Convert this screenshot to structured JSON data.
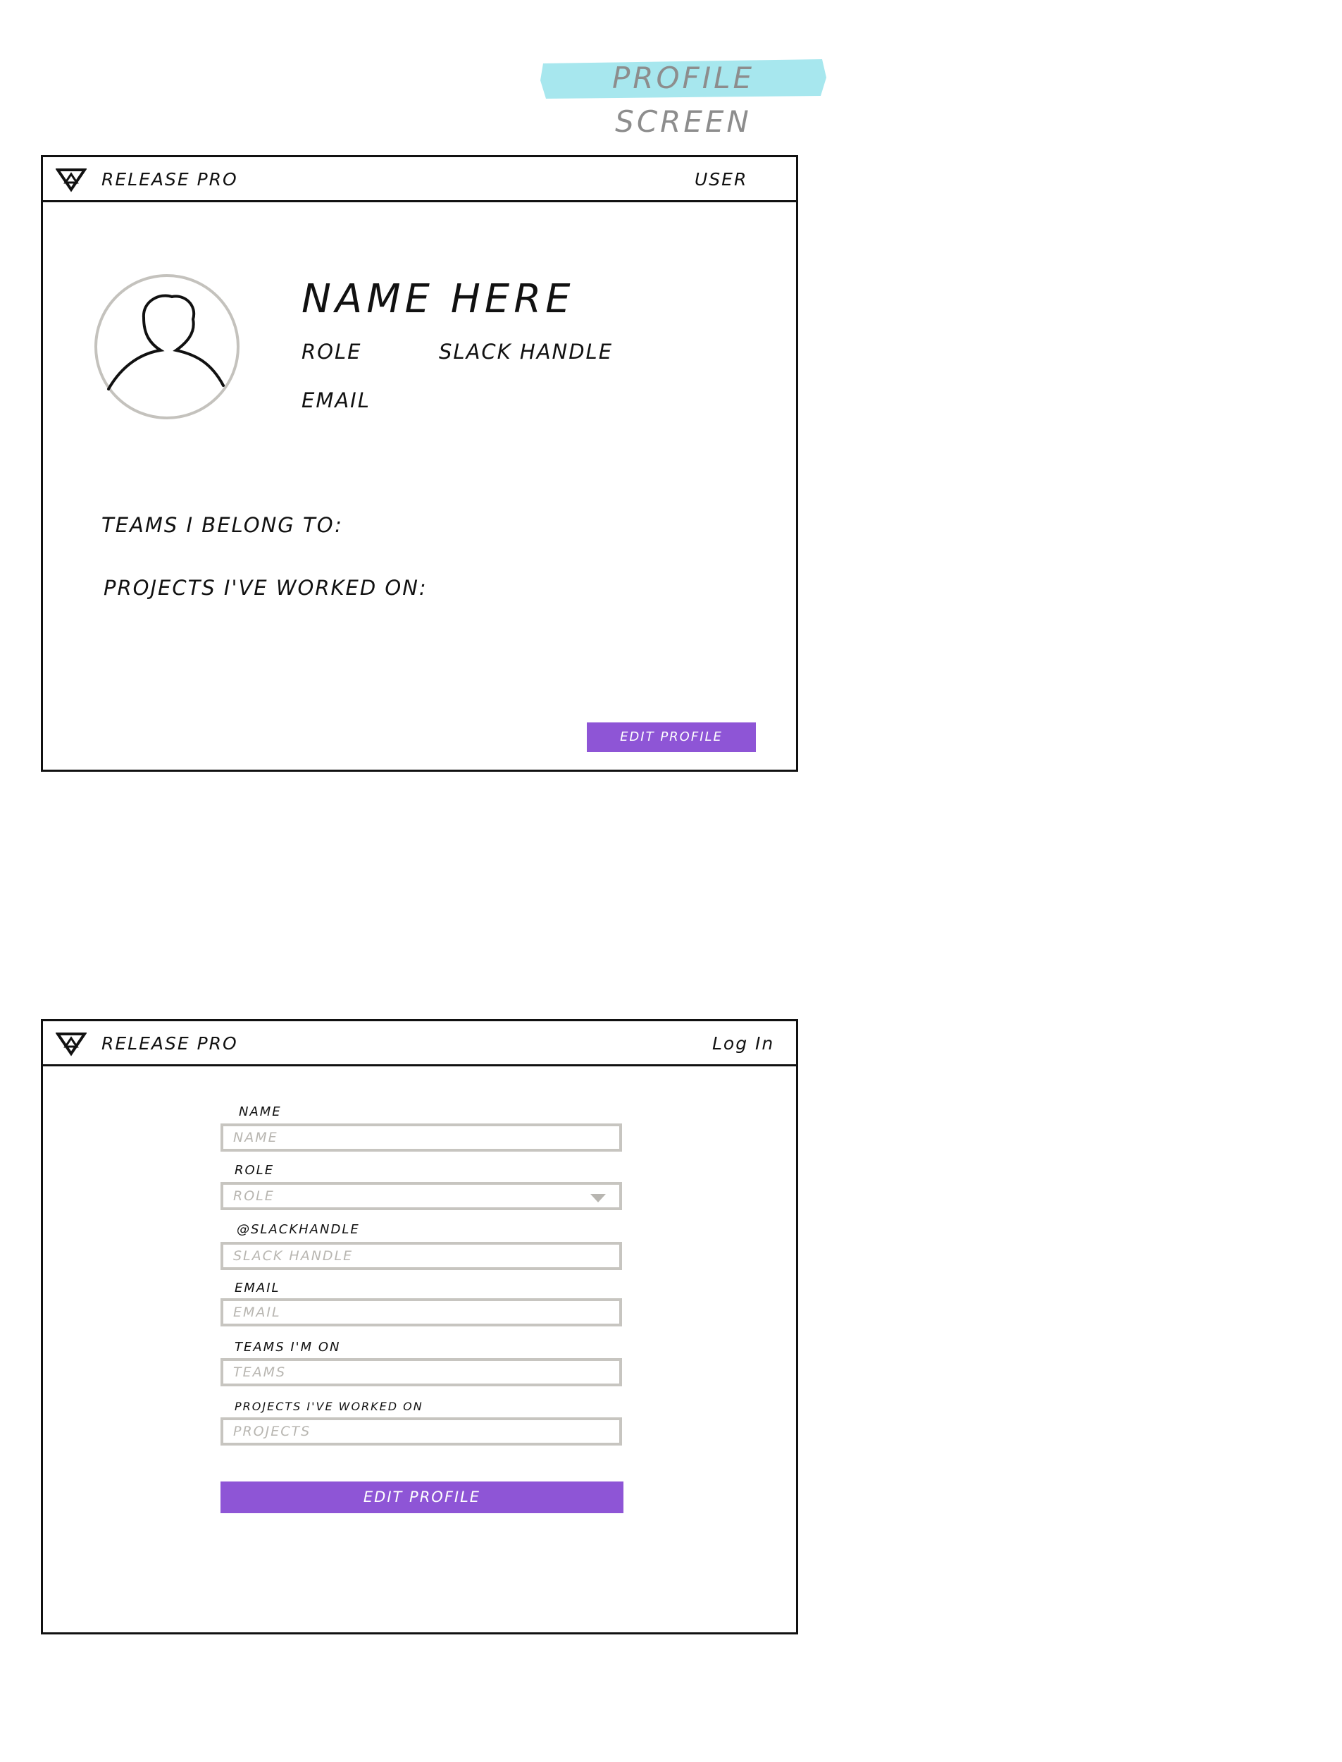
{
  "page": {
    "title": "PROFILE SCREEN",
    "title_highlight_color": "#a7e7ee"
  },
  "profile_view": {
    "brand": "RELEASE PRO",
    "logo_icon": "triangle-logo-icon",
    "nav_user": "USER",
    "avatar_icon": "user-avatar-icon",
    "name": "NAME HERE",
    "role": "ROLE",
    "slack_handle": "SLACK HANDLE",
    "email": "EMAIL",
    "teams_label": "TEAMS I BELONG TO:",
    "projects_label": "PROJECTS I'VE WORKED ON:",
    "edit_button": "EDIT PROFILE"
  },
  "edit_view": {
    "brand": "RELEASE PRO",
    "logo_icon": "triangle-logo-icon",
    "nav_login": "Log In",
    "fields": [
      {
        "label": "NAME",
        "placeholder": "NAME",
        "type": "text"
      },
      {
        "label": "ROLE",
        "placeholder": "ROLE",
        "type": "select"
      },
      {
        "label": "@SLACKHANDLE",
        "placeholder": "SLACK HANDLE",
        "type": "text"
      },
      {
        "label": "EMAIL",
        "placeholder": "EMAIL",
        "type": "text"
      },
      {
        "label": "TEAMS I'M ON",
        "placeholder": "TEAMS",
        "type": "text"
      },
      {
        "label": "PROJECTS I'VE WORKED ON",
        "placeholder": "PROJECTS",
        "type": "text"
      }
    ],
    "edit_button": "EDIT PROFILE"
  },
  "colors": {
    "accent": "#8e55d6",
    "border": "#111111",
    "input_border": "#c7c5c0",
    "placeholder": "#b8b6b1"
  }
}
